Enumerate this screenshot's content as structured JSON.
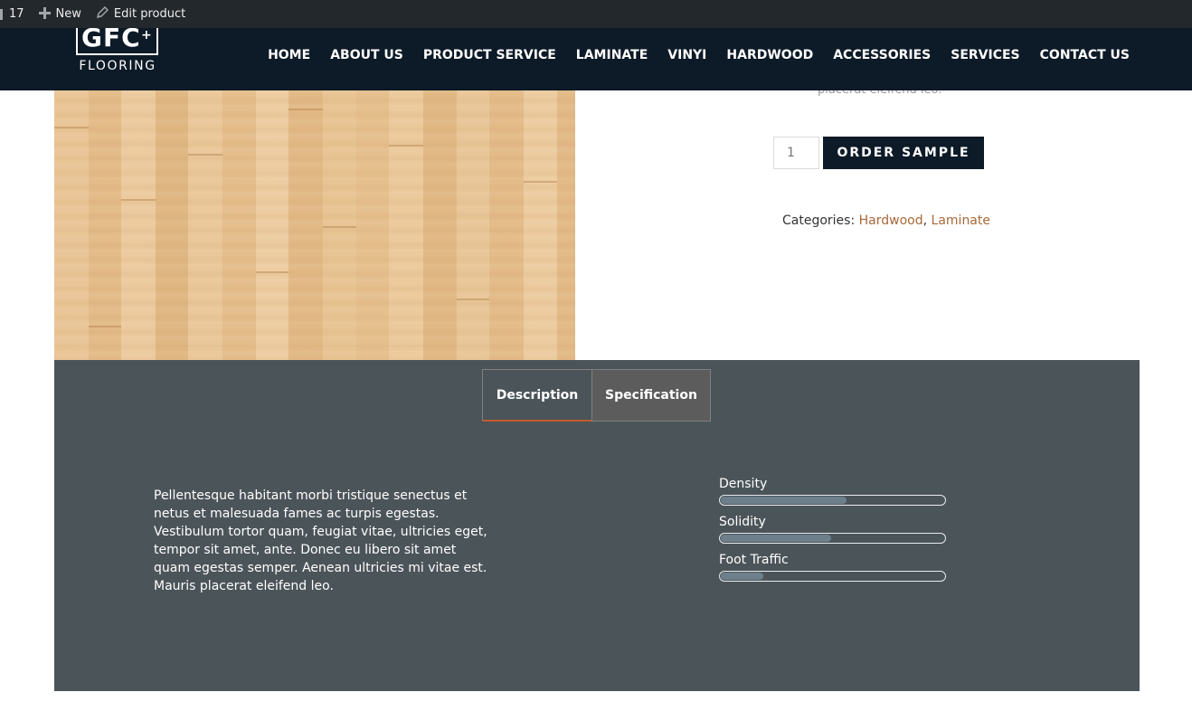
{
  "admin_bar": {
    "count": "17",
    "new_label": "New",
    "edit_label": "Edit product"
  },
  "header": {
    "logo_letters": "GFC",
    "logo_text": "FLOORING",
    "nav": [
      "HOME",
      "ABOUT US",
      "PRODUCT SERVICE",
      "LAMINATE",
      "VINYI",
      "HARDWOOD",
      "ACCESSORIES",
      "SERVICES",
      "CONTACT US"
    ]
  },
  "summary": {
    "peek_text": "placerat eleifend leo.",
    "quantity": "1",
    "order_button": "ORDER SAMPLE",
    "categories_label": "Categories:",
    "categories": [
      "Hardwood",
      "Laminate"
    ],
    "category_separator": ","
  },
  "tabs": {
    "items": [
      "Description",
      "Specification"
    ],
    "active": "Description"
  },
  "description": "Pellentesque habitant morbi tristique senectus et netus et malesuada fames ac turpis egestas. Vestibulum tortor quam, feugiat vitae, ultricies eget, tempor sit amet, ante. Donec eu libero sit amet quam egestas semper. Aenean ultricies mi vitae est. Mauris placerat eleifend leo.",
  "specs": [
    {
      "label": "Density",
      "level": 0.56
    },
    {
      "label": "Solidity",
      "level": 0.49
    },
    {
      "label": "Foot Traffic",
      "level": 0.19
    }
  ],
  "colors": {
    "header_bg": "#0d1a27",
    "panel_bg": "#4b5459",
    "accent": "#a8683b",
    "tab_underline": "#c45a2b"
  },
  "icons": {
    "new": "plus-icon",
    "edit": "pencil-icon"
  }
}
